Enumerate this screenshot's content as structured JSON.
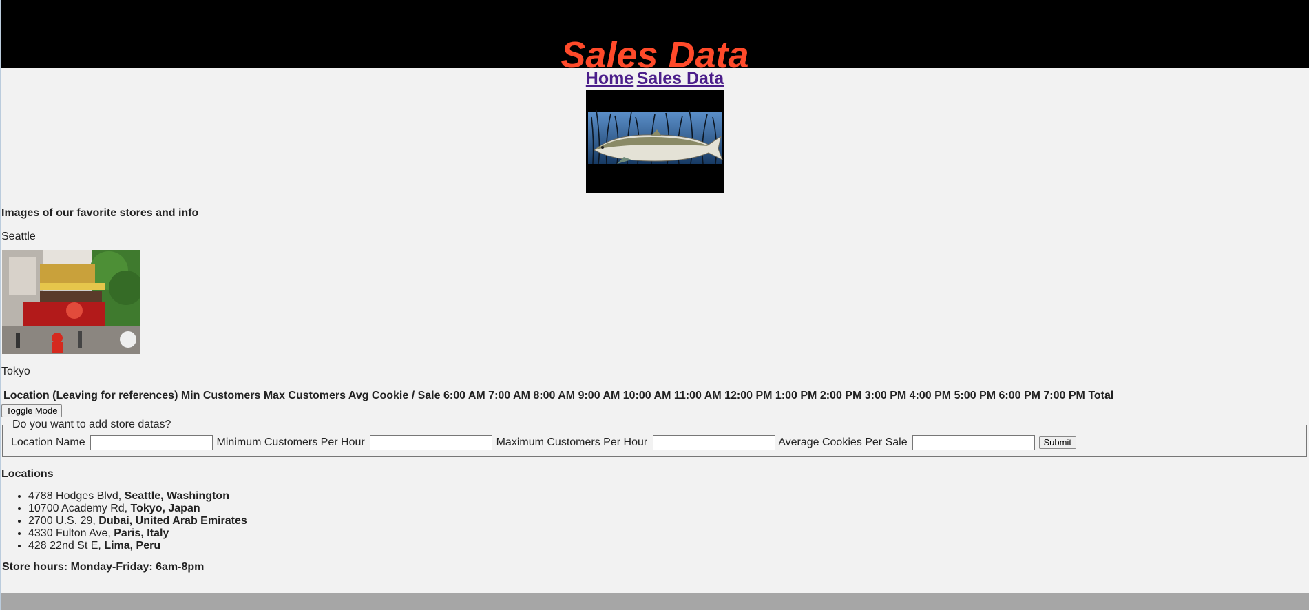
{
  "header": {
    "title": "Sales Data"
  },
  "nav": {
    "home": "Home",
    "sales": "Sales Data"
  },
  "favorites": {
    "title": "Images of our favorite stores and info",
    "city1": "Seattle",
    "city2": "Tokyo"
  },
  "table": {
    "header_text": "Location (Leaving for references) Min Customers Max Customers Avg Cookie / Sale 6:00 AM 7:00 AM 8:00 AM 9:00 AM 10:00 AM 11:00 AM 12:00 PM 1:00 PM 2:00 PM 3:00 PM 4:00 PM 5:00 PM 6:00 PM 7:00 PM Total"
  },
  "toggle_label": "Toggle Mode",
  "form": {
    "legend": "Do you want to add store datas?",
    "location_label": "Location Name",
    "min_label": "Minimum Customers Per Hour",
    "max_label": "Maximum Customers Per Hour",
    "avg_label": "Average Cookies Per Sale",
    "submit_label": "Submit"
  },
  "locations": {
    "title": "Locations",
    "items": [
      {
        "address": "4788 Hodges Blvd, ",
        "city": "Seattle, Washington"
      },
      {
        "address": "10700 Academy Rd, ",
        "city": "Tokyo, Japan"
      },
      {
        "address": "2700 U.S. 29, ",
        "city": "Dubai, United Arab Emirates"
      },
      {
        "address": "4330 Fulton Ave, ",
        "city": "Paris, Italy"
      },
      {
        "address": "428 22nd St E, ",
        "city": "Lima, Peru"
      }
    ]
  },
  "hours": "Store hours: Monday-Friday: 6am-8pm",
  "colors": {
    "title": "#ff4a2a",
    "link": "#4b1e8a",
    "header_bg": "#000000",
    "footer_bg": "#a6a6a6"
  }
}
